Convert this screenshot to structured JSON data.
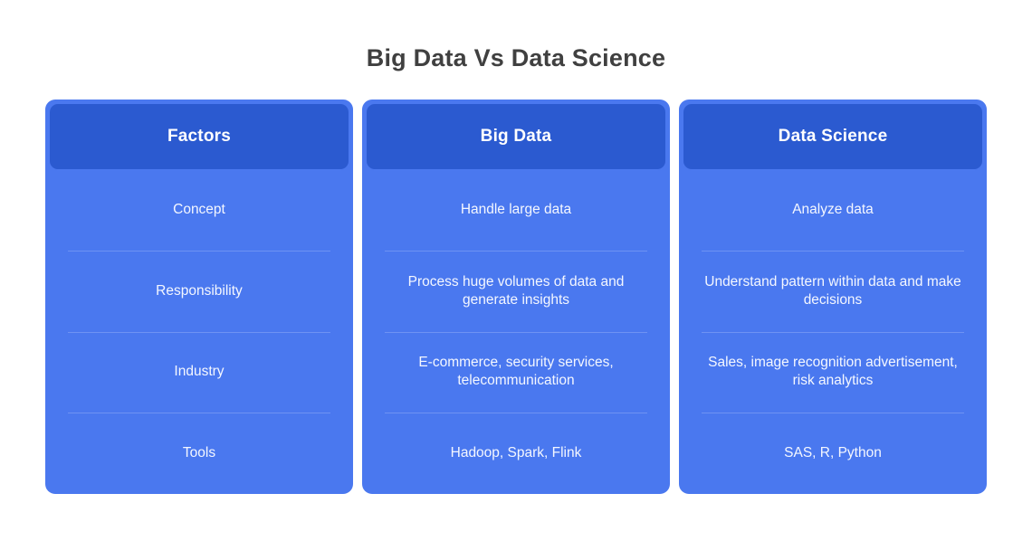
{
  "title": "Big Data Vs Data Science",
  "colors": {
    "card_background": "#4a78ef",
    "header_background": "#2b5ad0",
    "divider": "#6e93f3",
    "title_text": "#404040",
    "cell_text": "#f4f7ff",
    "page_background": "#ffffff"
  },
  "table": {
    "columns": [
      {
        "header": "Factors",
        "cells": [
          "Concept",
          "Responsibility",
          "Industry",
          "Tools"
        ]
      },
      {
        "header": "Big Data",
        "cells": [
          "Handle large data",
          "Process huge volumes of data and generate insights",
          "E-commerce, security services, telecommunication",
          "Hadoop, Spark, Flink"
        ]
      },
      {
        "header": "Data Science",
        "cells": [
          "Analyze data",
          "Understand pattern within data and make decisions",
          "Sales, image recognition advertisement, risk analytics",
          "SAS, R, Python"
        ]
      }
    ]
  }
}
